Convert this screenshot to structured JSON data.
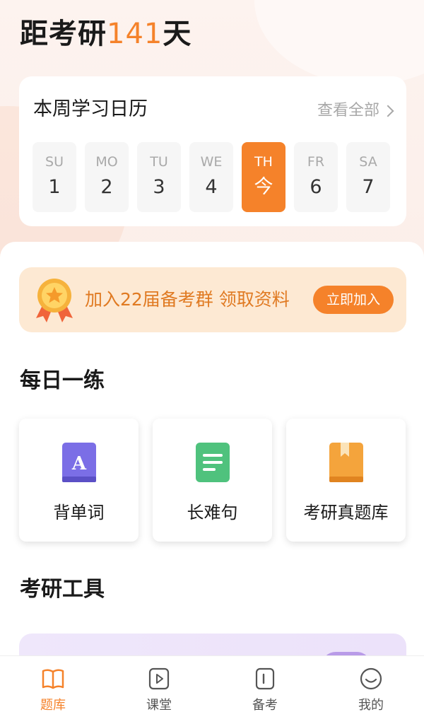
{
  "header": {
    "countdown_prefix": "距考研",
    "countdown_days": "141",
    "countdown_suffix": "天"
  },
  "calendar": {
    "title": "本周学习日历",
    "view_all": "查看全部",
    "days": [
      {
        "abbr": "SU",
        "date": "1"
      },
      {
        "abbr": "MO",
        "date": "2"
      },
      {
        "abbr": "TU",
        "date": "3"
      },
      {
        "abbr": "WE",
        "date": "4"
      },
      {
        "abbr": "TH",
        "date": "今",
        "today": true
      },
      {
        "abbr": "FR",
        "date": "6"
      },
      {
        "abbr": "SA",
        "date": "7"
      }
    ]
  },
  "banner": {
    "icon": "medal-icon",
    "text": "加入22届备考群 领取资料",
    "button": "立即加入"
  },
  "daily_practice": {
    "title": "每日一练",
    "items": [
      {
        "label": "背单词",
        "icon": "vocabulary-book-icon",
        "color": "#7b6ee6"
      },
      {
        "label": "长难句",
        "icon": "document-icon",
        "color": "#4fc27d"
      },
      {
        "label": "考研真题库",
        "icon": "question-bank-book-icon",
        "color": "#f4a43c"
      }
    ]
  },
  "tools": {
    "title": "考研工具"
  },
  "tabbar": {
    "items": [
      {
        "label": "题库",
        "icon": "open-book-icon",
        "active": true
      },
      {
        "label": "课堂",
        "icon": "play-video-icon",
        "active": false
      },
      {
        "label": "备考",
        "icon": "notebook-icon",
        "active": false
      },
      {
        "label": "我的",
        "icon": "smiley-profile-icon",
        "active": false
      }
    ]
  },
  "colors": {
    "accent": "#f5822a",
    "banner_bg": "#fde9d3",
    "banner_text": "#e07a22"
  }
}
